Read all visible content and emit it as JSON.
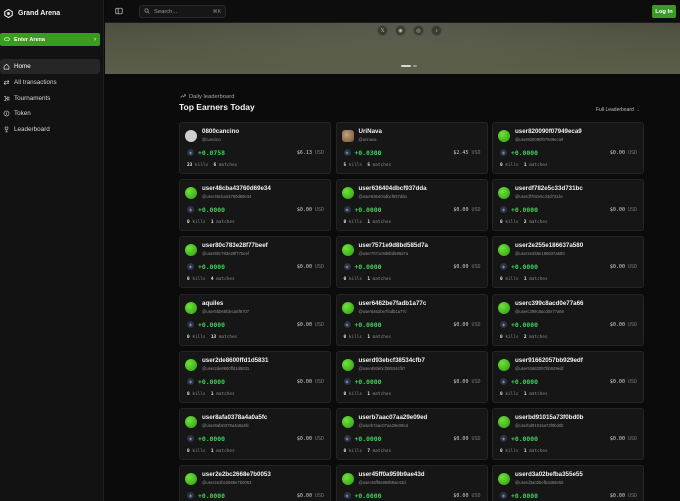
{
  "brand": {
    "name": "Grand Arena"
  },
  "sidebar": {
    "enter_label": "Enter Arena",
    "items": [
      {
        "label": "Home",
        "active": true
      },
      {
        "label": "All transactions",
        "active": false
      },
      {
        "label": "Tournaments",
        "active": false
      },
      {
        "label": "Token",
        "active": false
      },
      {
        "label": "Leaderboard",
        "active": false
      }
    ]
  },
  "topbar": {
    "search_placeholder": "Search...",
    "search_shortcut": "⌘K",
    "login_label": "Log In"
  },
  "banner": {
    "socials": [
      "x-icon",
      "discord-icon",
      "instagram-icon",
      "tiktok-icon"
    ]
  },
  "leaderboard": {
    "subtitle": "Daily leaderboard",
    "title": "Top Earners Today",
    "full_link": "Full Leaderboard →",
    "kills_label": "kills",
    "matches_label": "matches",
    "currency": "USD",
    "cards": [
      {
        "name": "0800cancino",
        "handle": "@cancino",
        "earn": "+0.0758",
        "usd": "$6.13",
        "kills": "23",
        "matches": "6",
        "avatar": "gray"
      },
      {
        "name": "UriNava",
        "handle": "@urinava",
        "earn": "+0.0300",
        "usd": "$2.45",
        "kills": "5",
        "matches": "5",
        "avatar": "brown"
      },
      {
        "name": "user820090f07949eca9",
        "handle": "@user820090f07949eca9",
        "earn": "+0.0000",
        "usd": "$0.00",
        "kills": "0",
        "matches": "1",
        "avatar": "green"
      },
      {
        "name": "user48cba43760d69e34",
        "handle": "@user48cba43760d69e34",
        "earn": "+0.0000",
        "usd": "$0.00",
        "kills": "0",
        "matches": "1",
        "avatar": "green"
      },
      {
        "name": "user636404dbcf937dda",
        "handle": "@user636404dbcf937dda",
        "earn": "+0.0000",
        "usd": "$0.00",
        "kills": "0",
        "matches": "1",
        "avatar": "green"
      },
      {
        "name": "userdf782e5c33d731bc",
        "handle": "@userdf782e5c33d731bc",
        "earn": "+0.0000",
        "usd": "$0.00",
        "kills": "0",
        "matches": "2",
        "avatar": "green"
      },
      {
        "name": "user80c783e28f77beef",
        "handle": "@user80c783e28f77beef",
        "earn": "+0.0000",
        "usd": "$0.00",
        "kills": "0",
        "matches": "4",
        "avatar": "green"
      },
      {
        "name": "user7571e9d8bd585d7a",
        "handle": "@user7571e9d8bd585d7a",
        "earn": "+0.0000",
        "usd": "$0.00",
        "kills": "0",
        "matches": "1",
        "avatar": "green"
      },
      {
        "name": "user2e255e186637a580",
        "handle": "@user2e255e186637a580",
        "earn": "+0.0000",
        "usd": "$0.00",
        "kills": "0",
        "matches": "1",
        "avatar": "green"
      },
      {
        "name": "aquiles",
        "handle": "@user5bb68fdeca6f6707",
        "earn": "+0.0000",
        "usd": "$0.00",
        "kills": "0",
        "matches": "13",
        "avatar": "green"
      },
      {
        "name": "user6462be7fadb1a77c",
        "handle": "@user6462be7fadb1a77c",
        "earn": "+0.0000",
        "usd": "$0.00",
        "kills": "0",
        "matches": "1",
        "avatar": "green"
      },
      {
        "name": "userc399c8acd0e77a66",
        "handle": "@userc399c8acd0e77a66",
        "earn": "+0.0000",
        "usd": "$0.00",
        "kills": "0",
        "matches": "2",
        "avatar": "green"
      },
      {
        "name": "user2de8600ffd1d5831",
        "handle": "@user2de8600ffd1d5831",
        "earn": "+0.0000",
        "usd": "$0.00",
        "kills": "0",
        "matches": "1",
        "avatar": "green"
      },
      {
        "name": "userd93ebcf38534cfb7",
        "handle": "@userd93ebcf38534cfb7",
        "earn": "+0.0000",
        "usd": "$0.00",
        "kills": "0",
        "matches": "1",
        "avatar": "green"
      },
      {
        "name": "user91662057bb929edf",
        "handle": "@user91662057bb929edf",
        "earn": "+0.0000",
        "usd": "$0.00",
        "kills": "0",
        "matches": "1",
        "avatar": "green"
      },
      {
        "name": "user8afa0378a4a0a5fc",
        "handle": "@user8afa0378a4a0a5fc",
        "earn": "+0.0000",
        "usd": "$0.00",
        "kills": "0",
        "matches": "1",
        "avatar": "green"
      },
      {
        "name": "userb7aac07aa29e09ed",
        "handle": "@userb7aac07aa29e09ed",
        "earn": "+0.0000",
        "usd": "$0.00",
        "kills": "0",
        "matches": "7",
        "avatar": "green"
      },
      {
        "name": "userbd91015a73f0bd0b",
        "handle": "@userbd91015a73f0bd0b",
        "earn": "+0.0000",
        "usd": "$0.00",
        "kills": "0",
        "matches": "1",
        "avatar": "green"
      },
      {
        "name": "user2e2bc2668e7b0053",
        "handle": "@user2e2bc2668e7b0053",
        "earn": "+0.0000",
        "usd": "$0.00",
        "kills": "",
        "matches": "",
        "avatar": "green"
      },
      {
        "name": "user45ff0a959b9ae43d",
        "handle": "@user45ff0a959b9ae43d",
        "earn": "+0.0000",
        "usd": "$0.00",
        "kills": "",
        "matches": "",
        "avatar": "green"
      },
      {
        "name": "userd3a02befba355e55",
        "handle": "@userd3a02befba355e55",
        "earn": "+0.0000",
        "usd": "$0.00",
        "kills": "",
        "matches": "",
        "avatar": "green"
      }
    ]
  },
  "colors": {
    "accent": "#3b9b1e",
    "positive": "#40d05a",
    "bg": "#0b0b0c",
    "card": "#161617"
  }
}
